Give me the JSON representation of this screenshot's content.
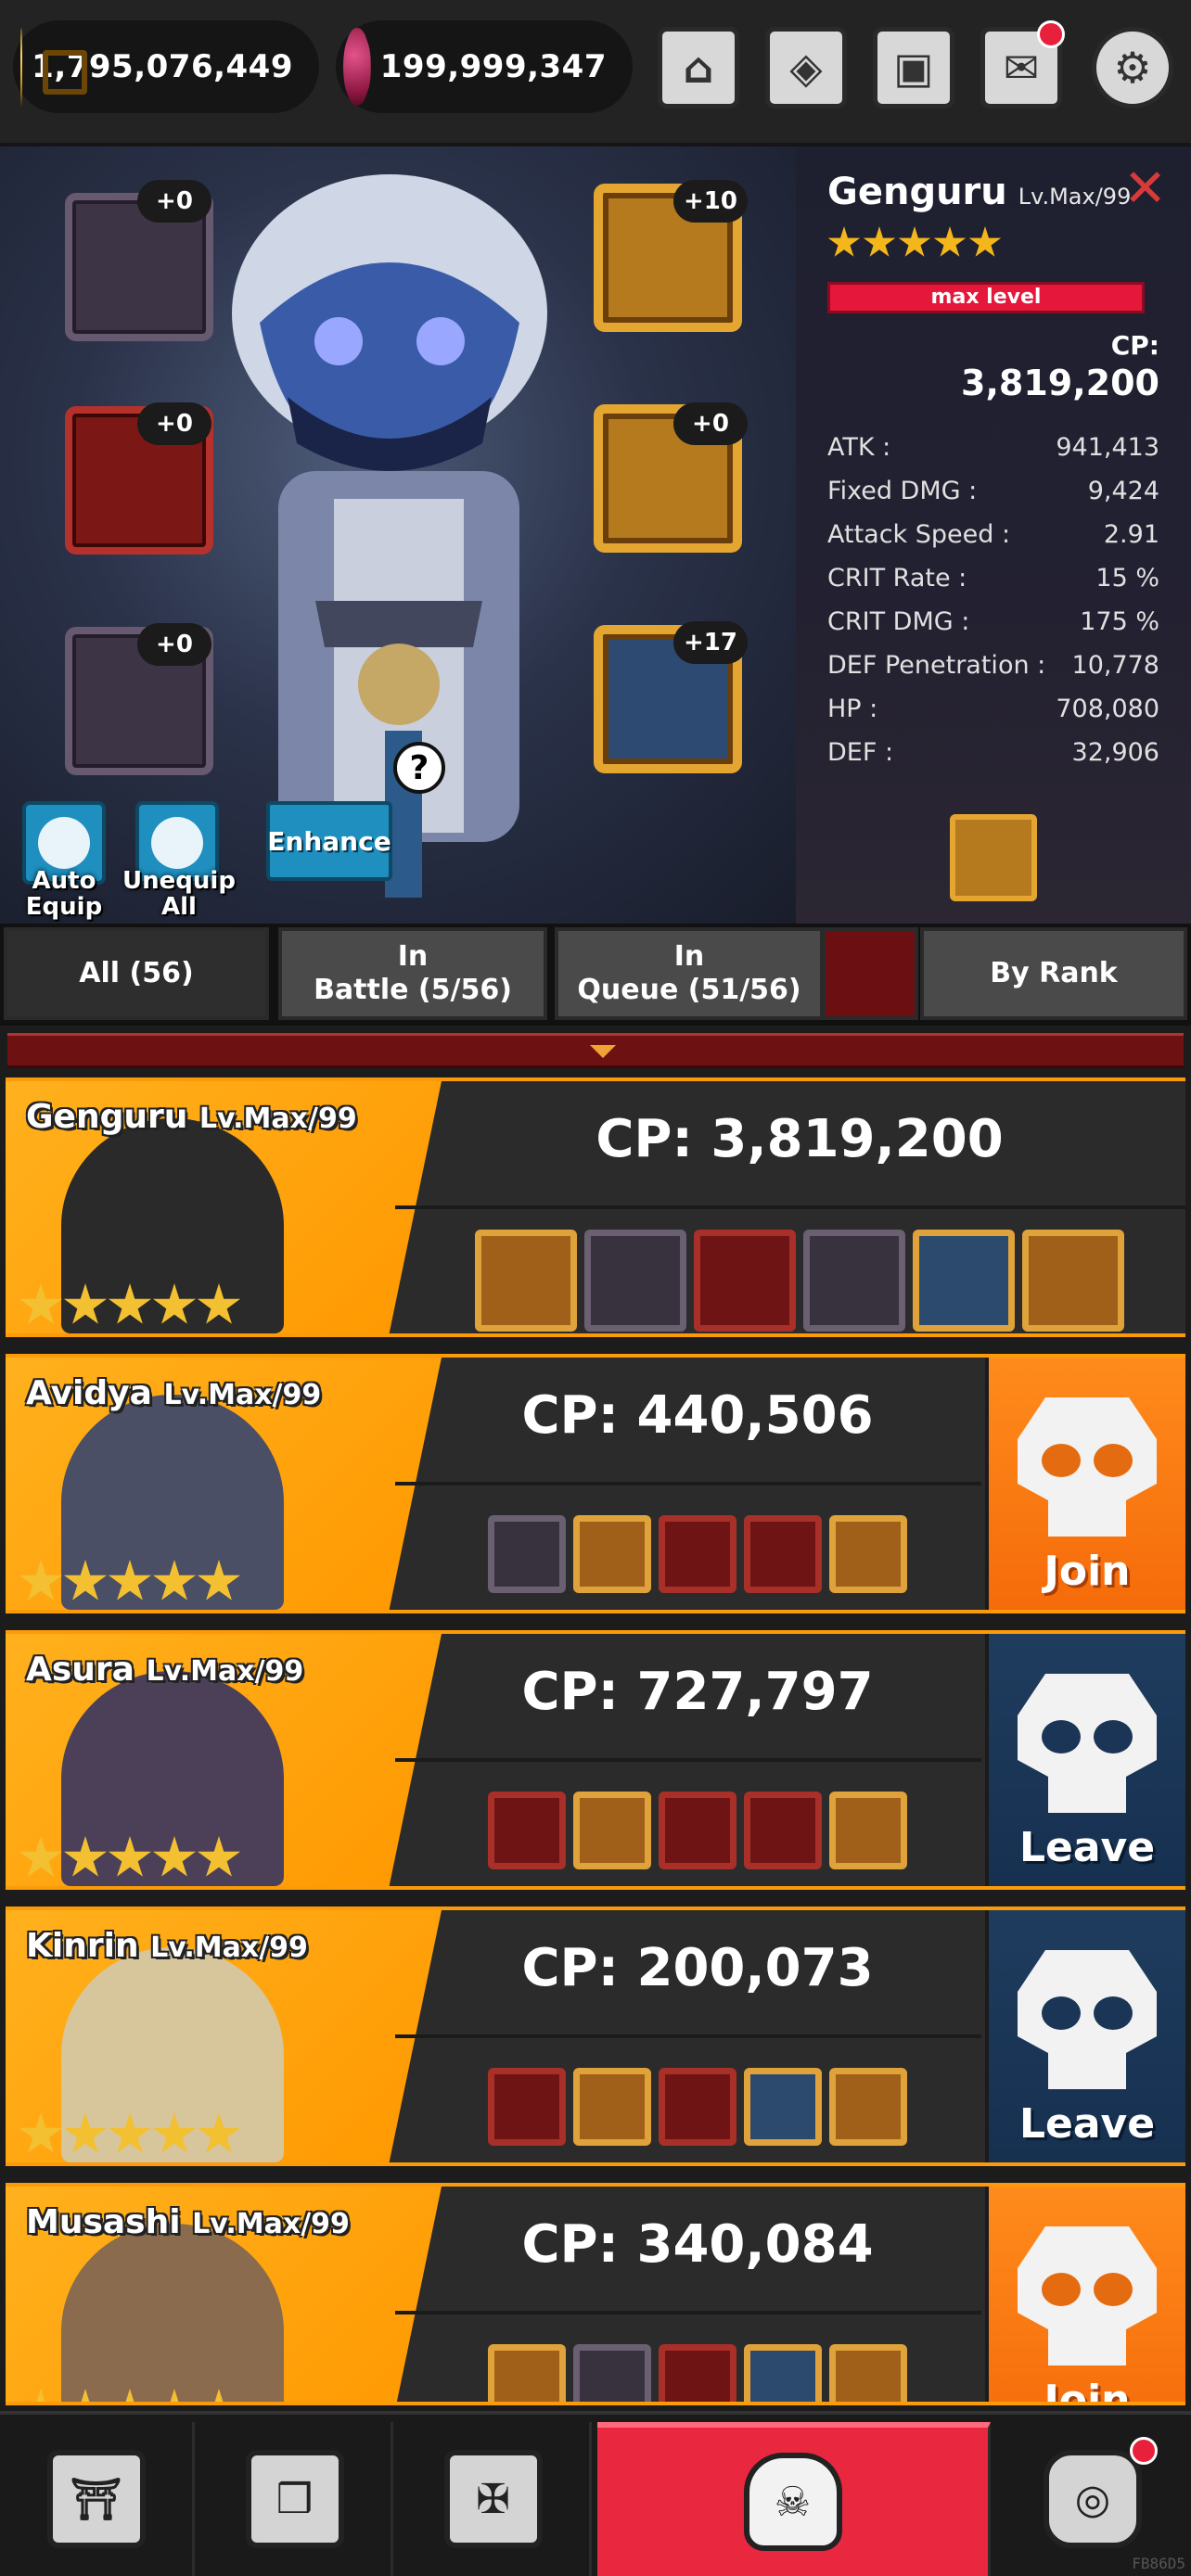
{
  "currency": {
    "gold": "1,795,076,449",
    "gems": "199,999,347"
  },
  "top_icons": [
    "shop-icon",
    "scroll-icon",
    "backpack-icon",
    "mail-icon",
    "settings-icon"
  ],
  "hero": {
    "name": "Genguru",
    "level": "Lv.Max/99",
    "stars": 5,
    "max_level_label": "max level",
    "cp_label": "CP:",
    "cp": "3,819,200",
    "stats": [
      {
        "label": "ATK :",
        "value": "941,413"
      },
      {
        "label": "Fixed DMG :",
        "value": "9,424"
      },
      {
        "label": "Attack Speed :",
        "value": "2.91"
      },
      {
        "label": "CRIT Rate :",
        "value": "15 %"
      },
      {
        "label": "CRIT DMG :",
        "value": "175 %"
      },
      {
        "label": "DEF Penetration :",
        "value": "10,778"
      },
      {
        "label": "HP :",
        "value": "708,080"
      },
      {
        "label": "DEF :",
        "value": "32,906"
      }
    ],
    "equipment": {
      "left": [
        "+0",
        "+0",
        "+0"
      ],
      "right": [
        "+10",
        "+0",
        "+17"
      ]
    },
    "buttons": {
      "auto_equip": "Auto\nEquip",
      "unequip_all": "Unequip\nAll",
      "enhance": "Enhance",
      "help": "?"
    }
  },
  "tabs": {
    "all": "All (56)",
    "in_battle": "In\nBattle (5/56)",
    "in_queue": "In\nQueue (51/56)",
    "sort": "By Rank"
  },
  "cards": [
    {
      "name": "Genguru",
      "level": "Lv.Max/99",
      "cp": "CP: 3,819,200",
      "action": "",
      "items": [
        "gold",
        "grey",
        "red",
        "grey",
        "blue",
        "gold"
      ]
    },
    {
      "name": "Avidya",
      "level": "Lv.Max/99",
      "cp": "CP: 440,506",
      "action": "Join",
      "items": [
        "grey",
        "gold",
        "red",
        "red",
        "gold"
      ]
    },
    {
      "name": "Asura",
      "level": "Lv.Max/99",
      "cp": "CP: 727,797",
      "action": "Leave",
      "items": [
        "red",
        "gold",
        "red",
        "red",
        "gold"
      ]
    },
    {
      "name": "Kinrin",
      "level": "Lv.Max/99",
      "cp": "CP: 200,073",
      "action": "Leave",
      "items": [
        "red",
        "gold",
        "red",
        "blue",
        "gold"
      ]
    },
    {
      "name": "Musashi",
      "level": "Lv.Max/99",
      "cp": "CP: 340,084",
      "action": "Join",
      "items": [
        "gold",
        "grey",
        "red",
        "blue",
        "gold"
      ]
    }
  ],
  "bottom_nav": [
    "dojo-icon",
    "cards-icon",
    "weapons-icon",
    "skull-icon",
    "lantern-icon"
  ],
  "footer_code": "FB86D5",
  "colors": {
    "accent_orange": "#fc9b0a",
    "join_orange": "#f56b0a",
    "leave_blue": "#1f3c5e",
    "nav_active_red": "#e9273f",
    "max_level_red": "#e5173a"
  }
}
